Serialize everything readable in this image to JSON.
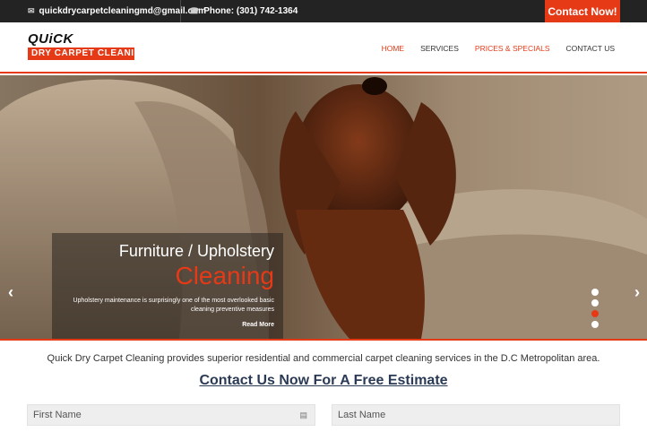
{
  "topbar": {
    "email": "quickdrycarpetcleaningmd@gmail.com",
    "phone": "Phone: (301) 742-1364",
    "contact_button": "Contact Now!"
  },
  "logo": {
    "top": "QUiCK",
    "bottom": "DRY CARPET CLEANING"
  },
  "nav": {
    "items": [
      "HOME",
      "SERVICES",
      "PRICES & SPECIALS",
      "CONTACT US"
    ],
    "active": "HOME"
  },
  "hero": {
    "title": "Furniture / Upholstery",
    "subtitle": "Cleaning",
    "text": "Upholstery maintenance is surprisingly one of the most overlooked basic cleaning preventive measures",
    "read_more": "Read More",
    "slides": 4,
    "active_slide": 3
  },
  "intro": "Quick Dry Carpet Cleaning provides superior residential and commercial carpet cleaning services in the D.C Metropolitan area.",
  "cta_heading": "Contact Us Now For A Free Estimate",
  "form": {
    "first_name_placeholder": "First Name",
    "last_name_placeholder": "Last Name"
  },
  "colors": {
    "accent": "#e63a17",
    "topbar": "#232323",
    "heading": "#2b3a55"
  }
}
